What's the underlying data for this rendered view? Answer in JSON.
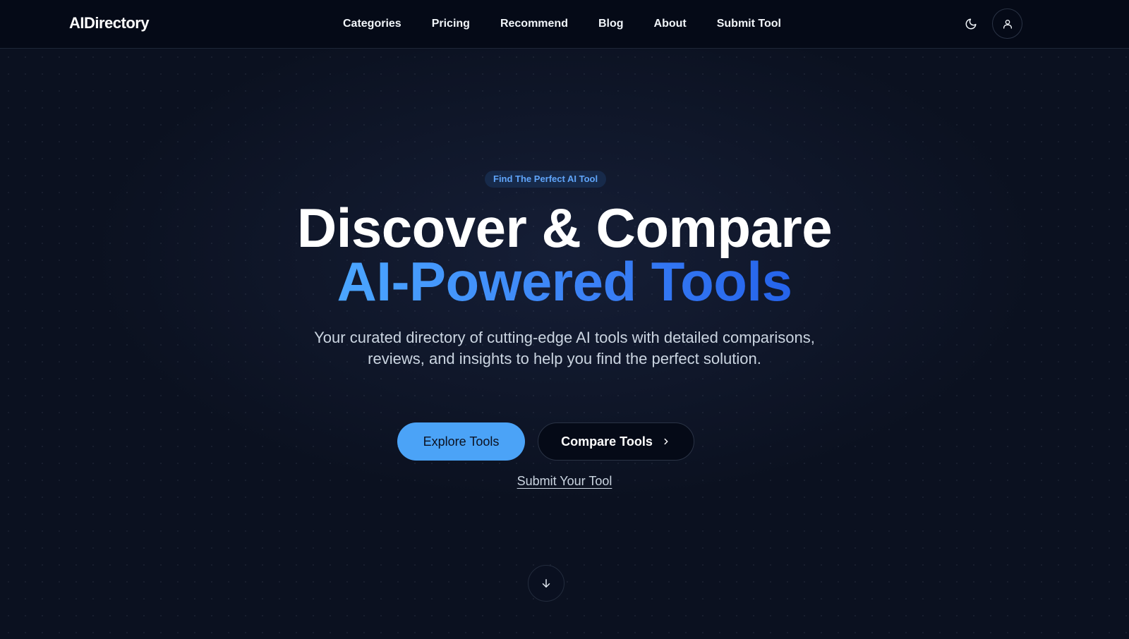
{
  "header": {
    "logo": "AIDirectory",
    "nav": [
      {
        "label": "Categories"
      },
      {
        "label": "Pricing"
      },
      {
        "label": "Recommend"
      },
      {
        "label": "Blog"
      },
      {
        "label": "About"
      },
      {
        "label": "Submit Tool"
      }
    ],
    "theme_icon": "moon-icon",
    "user_icon": "user-icon"
  },
  "hero": {
    "badge": "Find The Perfect AI Tool",
    "title_line1": "Discover & Compare",
    "title_line2": "AI-Powered Tools",
    "subtitle": "Your curated directory of cutting-edge AI tools with detailed comparisons, reviews, and insights to help you find the perfect solution.",
    "primary_button": "Explore Tools",
    "secondary_button": "Compare Tools",
    "secondary_button_icon": "chevron-right-icon",
    "submit_link": "Submit Your Tool",
    "scroll_icon": "arrow-down-icon"
  },
  "colors": {
    "background": "#0b1120",
    "header_background": "#050a17",
    "accent": "#4ba3f7",
    "gradient_start": "#4ba6ff",
    "gradient_end": "#2563eb",
    "badge_background": "#172a4a",
    "badge_text": "#60a5fa"
  }
}
